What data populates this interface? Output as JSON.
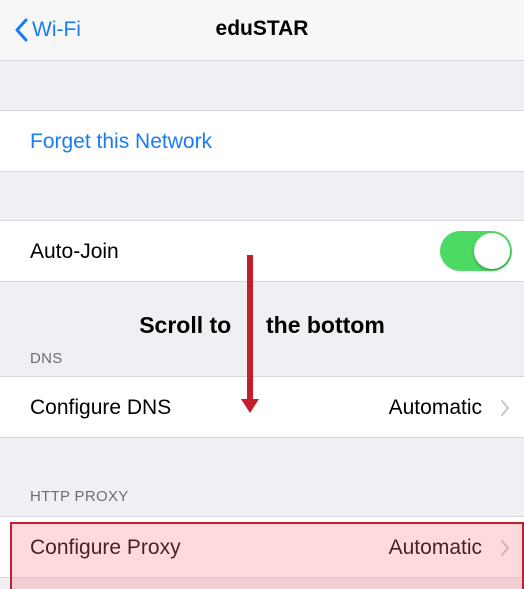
{
  "nav": {
    "back_label": "Wi-Fi",
    "title": "eduSTAR"
  },
  "forget": {
    "label": "Forget this Network"
  },
  "auto_join": {
    "label": "Auto-Join",
    "enabled": true
  },
  "dns": {
    "header": "DNS",
    "configure_label": "Configure DNS",
    "configure_value": "Automatic"
  },
  "proxy": {
    "header": "HTTP PROXY",
    "configure_label": "Configure Proxy",
    "configure_value": "Automatic"
  },
  "annotation": {
    "part1": "Scroll to",
    "part2": "the bottom",
    "arrow_color": "#c0202c"
  },
  "colors": {
    "accent": "#1a7cf5",
    "toggle_on": "#4cd964",
    "highlight": "#c0202c"
  }
}
